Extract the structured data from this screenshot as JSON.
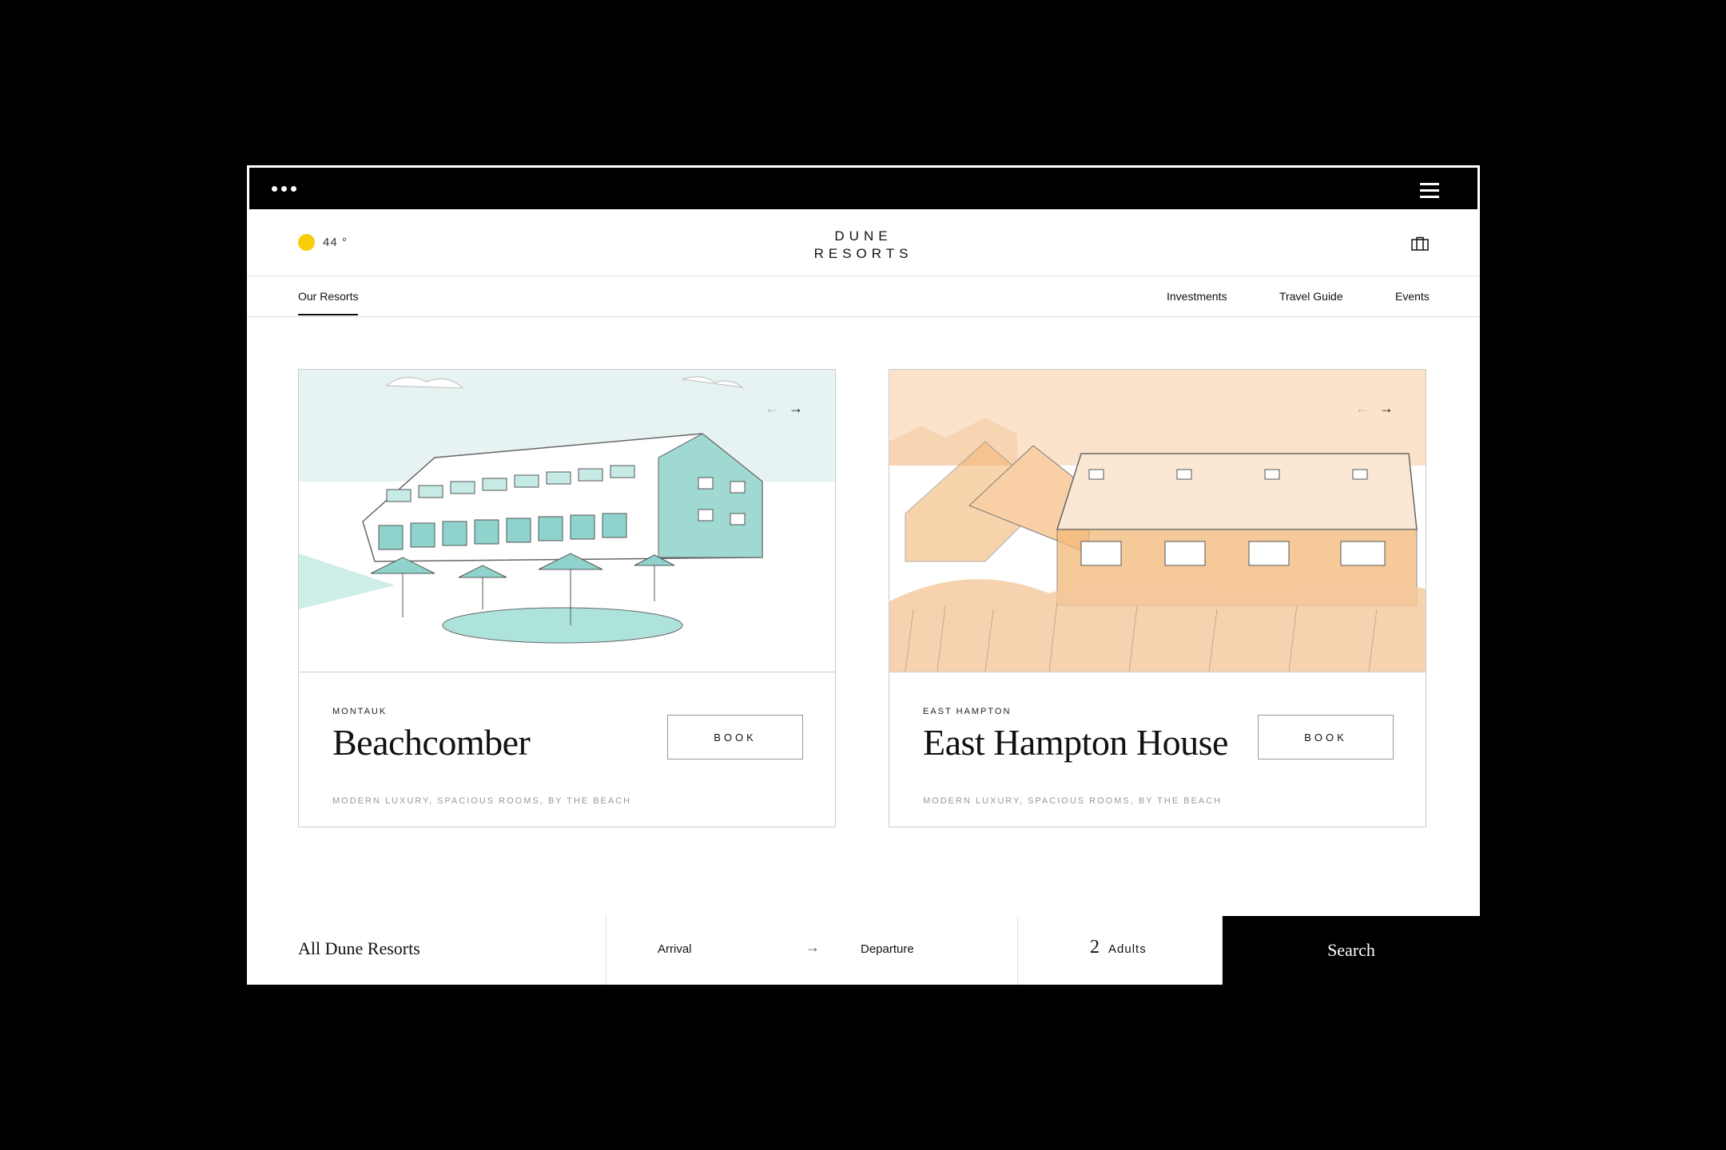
{
  "header": {
    "temperature": "44 °",
    "logo_line1": "DUNE",
    "logo_line2": "RESORTS"
  },
  "nav": {
    "active": "Our Resorts",
    "links": [
      "Investments",
      "Travel Guide",
      "Events"
    ]
  },
  "resorts": [
    {
      "location": "MONTAUK",
      "name": "Beachcomber",
      "book_label": "BOOK",
      "tagline": "MODERN LUXURY, SPACIOUS ROOMS, BY THE BEACH",
      "accent": "#8fd3cc"
    },
    {
      "location": "EAST HAMPTON",
      "name": "East Hampton House",
      "book_label": "BOOK",
      "tagline": "MODERN LUXURY, SPACIOUS ROOMS, BY THE BEACH",
      "accent": "#f4b878"
    }
  ],
  "booking": {
    "resort": "All Dune Resorts",
    "arrival": "Arrival",
    "departure": "Departure",
    "adults_count": "2",
    "adults_label": "Adults",
    "search_label": "Search"
  },
  "colors": {
    "sun": "#f6cd08"
  }
}
